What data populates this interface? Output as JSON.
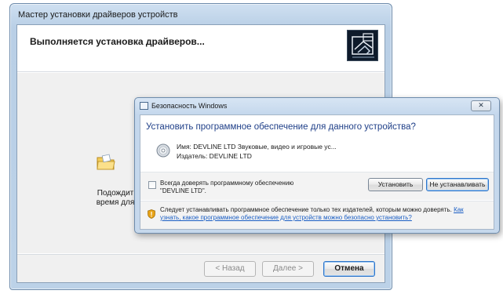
{
  "wizard": {
    "title": "Мастер установки драйверов устройств",
    "heading": "Выполняется установка драйверов...",
    "wait_line1": "Подождит",
    "wait_line2": "время для",
    "back_label": "< Назад",
    "next_label": "Далее >",
    "cancel_label": "Отмена"
  },
  "security_dialog": {
    "title": "Безопасность Windows",
    "close_label": "✕",
    "question": "Установить программное обеспечение для данного устройства?",
    "name_line": "Имя: DEVLINE LTD Звуковые, видео и игровые ус...",
    "publisher_line": "Издатель: DEVLINE LTD",
    "always_trust_line1": "Всегда доверять программному обеспечению",
    "always_trust_line2": "\"DEVLINE LTD\".",
    "always_trust_checked": false,
    "install_label": "Установить",
    "dont_install_label": "Не устанавливать",
    "note_text": "Следует устанавливать программное обеспечение только тех издателей, которым можно доверять.",
    "note_link_start": "Как",
    "note_link_rest": "узнать, какое программное обеспечение для устройств можно безопасно установить?"
  },
  "icons": {
    "wizard_logo": "device-install-icon",
    "wizard_folder": "folder-icon",
    "disc": "disc-icon",
    "shield": "shield-warning-icon",
    "dialog": "window-icon"
  },
  "colors": {
    "question_text": "#1f3f88",
    "link": "#1a5ec4",
    "window_frame": "#c4d7ec"
  }
}
